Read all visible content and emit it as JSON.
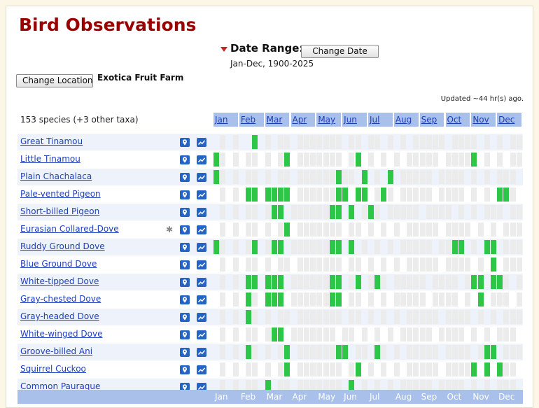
{
  "title": "Bird Observations",
  "date_range": {
    "label": "Date Range:",
    "value": "Jan-Dec, 1900-2025",
    "button": "Change Date"
  },
  "location": {
    "button": "Change Location",
    "name": "Exotica Fruit Farm"
  },
  "updated": "Updated ~44 hr(s) ago.",
  "species_count": "153 species (+3 other taxa)",
  "months": [
    "Jan",
    "Feb",
    "Mar",
    "Apr",
    "May",
    "Jun",
    "Jul",
    "Aug",
    "Sep",
    "Oct",
    "Nov",
    "Dec"
  ],
  "colors": {
    "title": "#9a0000",
    "link": "#1e3fbb",
    "month_band": "#a9c0ea",
    "present": "#2ec646",
    "row_alt": "#eef3fb"
  },
  "icons": {
    "map": "map-icon",
    "chart": "chart-icon",
    "exotic": "asterisk-icon",
    "collapse": "triangle-down-icon"
  },
  "species": [
    {
      "name": "Great Tinamou",
      "exotic": false,
      "weeks": ".d.d..G.d.dd.ddddddd.dd.dd.d.d.ddddd.dddd.d.d.ddd.ddddd.d..."
    },
    {
      "name": "Little Tinamou",
      "exotic": false,
      "weeks": "Gd.d.dd.d.dG.ddddddd.dG.d.d.d.ddddd.ddddG.d.d.ddd.ddddd.d..."
    },
    {
      "name": "Plain Chachalaca",
      "exotic": false,
      "weeks": "Gd.d.dd.d.dd.ddddddGdd.G.d.G.ddddd.dddd.d.d.ddd.ddddd.d..."
    },
    {
      "name": "Pale-vented Pigeon",
      "exotic": false,
      "weeks": ".d.d.GG.GGGG.ddddddGG.GG.dGd.ddddd.dddd.d.d.GGd.ddddd.dG..."
    },
    {
      "name": "Short-billed Pigeon",
      "exotic": false,
      "weeks": ".d.d.dd.dGG.ddddddGG.G.dGd.ddddd.dddd.d.d.ddd.ddddd.d..."
    },
    {
      "name": "Eurasian Collared-Dove",
      "exotic": true,
      "weeks": ".d.d.dd.d.dG.ddddddd.dd.d.d.d.ddddd.dddd.d.d.ddd.ddddd.d..."
    },
    {
      "name": "Ruddy Ground Dove",
      "exotic": false,
      "weeks": "Gd.d.dG.dGG.ddddddGG.G.d.d.d.ddddd.ddGG.d.GG.ddd.ddddd.dG..."
    },
    {
      "name": "Blue Ground Dove",
      "exotic": false,
      "weeks": ".d.d.dd.d.dd.ddddddd.dd.d.d.d.ddddd.dddd.d.G.ddd.ddddd.d..."
    },
    {
      "name": "White-tipped Dove",
      "exotic": false,
      "weeks": ".d.d.GG.GGG.ddddddGG.dG.dGd.ddddd.dddd.dGG.GGd.ddddd.dG..."
    },
    {
      "name": "Gray-chested Dove",
      "exotic": false,
      "weeks": ".d.d.Gd.GGG.ddddddGG.dd.d.d.ddddd.dddd.d.G.ddd.ddddd.d..."
    },
    {
      "name": "Gray-headed Dove",
      "exotic": false,
      "weeks": ".d.d.Gd.d.dd.ddddddd.dd.d.d.d.ddddd.dddd.d.d.ddd.ddddd.d..."
    },
    {
      "name": "White-winged Dove",
      "exotic": false,
      "weeks": ".d.d.dd.dGG.ddddddd.dd.d.d.d.ddddd.dddd.d.d.ddd.ddddd.d..."
    },
    {
      "name": "Groove-billed Ani",
      "exotic": false,
      "weeks": ".d.d.Gd.d.dG.ddddddGG.dd.Gd.d.ddddd.dddd.dGG.ddd.ddddd.d..."
    },
    {
      "name": "Squirrel Cuckoo",
      "exotic": false,
      "weeks": ".d.d.dd.d.dG.ddddddd.dG.d.d.d.ddddd.ddddG.G.Gdd.ddddd.dG..."
    },
    {
      "name": "Common Pauraque",
      "exotic": false,
      "weeks": ".d.d.dd.G.dd.ddddddd.G.d.d.d.ddddd.dddd.d.d.ddd.ddddd.d..."
    }
  ]
}
